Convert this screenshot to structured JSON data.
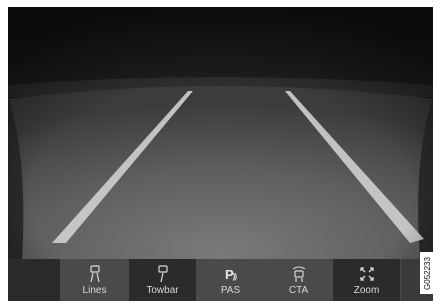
{
  "toolbar": {
    "buttons": [
      {
        "label": "Lines",
        "icon": "lines-icon",
        "active": false
      },
      {
        "label": "Towbar",
        "icon": "towbar-icon",
        "active": true
      },
      {
        "label": "PAS",
        "icon": "pas-icon",
        "active": false
      },
      {
        "label": "CTA",
        "icon": "cta-icon",
        "active": false
      },
      {
        "label": "Zoom",
        "icon": "zoom-icon",
        "active": true
      }
    ]
  },
  "reference_code": "G052233",
  "colors": {
    "sky": "#1e1e1e",
    "road": "#6a6a6a",
    "lane_line": "#c8c8c8",
    "toolbar": "#4a4a4a",
    "toolbar_active": "#2b2b2b",
    "label": "#d8d8d8"
  }
}
